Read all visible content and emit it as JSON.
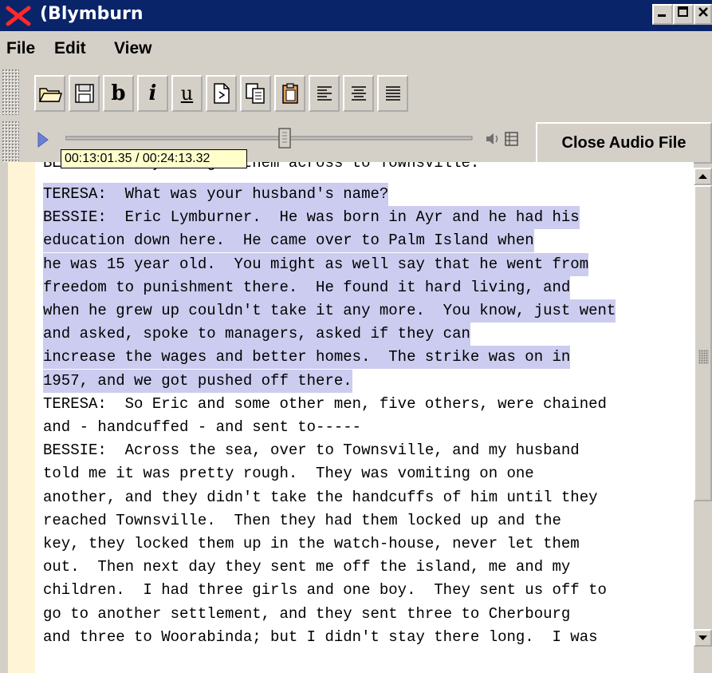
{
  "window": {
    "title": "(Blymburn"
  },
  "menu": {
    "file": "File",
    "edit": "Edit",
    "view": "View"
  },
  "toolbar": {
    "buttons": [
      "open",
      "save",
      "b",
      "i",
      "u",
      "new-page",
      "copy-page",
      "paste",
      "align-left",
      "align-center",
      "align-justify"
    ],
    "bold_label": "b",
    "italic_label": "i",
    "underline_label": "u"
  },
  "audio": {
    "position_fraction": 0.54,
    "time_display": "00:13:01.35 / 00:24:13.32",
    "close_label": "Close Audio File"
  },
  "transcript": {
    "lines": [
      {
        "text": "TERESA:  What was your husband's name?",
        "selected": true
      },
      {
        "text": "BESSIE:  Eric Lymburner.  He was born in Ayr and he had his",
        "selected": true
      },
      {
        "text": "education down here.  He came over to Palm Island when",
        "selected": true
      },
      {
        "text": "he was 15 year old.  You might as well say that he went from",
        "selected": true
      },
      {
        "text": "freedom to punishment there.  He found it hard living, and",
        "selected": true
      },
      {
        "text": "when he grew up couldn't take it any more.  You know, just went",
        "selected": true
      },
      {
        "text": "and asked, spoke to managers, asked if they can",
        "selected": true
      },
      {
        "text": "increase the wages and better homes.  The strike was on in",
        "selected": true
      },
      {
        "text": "1957, and we got pushed off there.",
        "selected": true
      },
      {
        "text": "TERESA:  So Eric and some other men, five others, were chained",
        "selected": false
      },
      {
        "text": "and - handcuffed - and sent to-----",
        "selected": false
      },
      {
        "text": "BESSIE:  Across the sea, over to Townsville, and my husband",
        "selected": false
      },
      {
        "text": "told me it was pretty rough.  They was vomiting on one",
        "selected": false
      },
      {
        "text": "another, and they didn't take the handcuffs of him until they",
        "selected": false
      },
      {
        "text": "reached Townsville.  Then they had them locked up and the",
        "selected": false
      },
      {
        "text": "key, they locked them up in the watch-house, never let them",
        "selected": false
      },
      {
        "text": "out.  Then next day they sent me off the island, me and my",
        "selected": false
      },
      {
        "text": "children.  I had three girls and one boy.  They sent us off to",
        "selected": false
      },
      {
        "text": "go to another settlement, and they sent three to Cherbourg",
        "selected": false
      },
      {
        "text": "and three to Woorabinda; but I didn't stay there long.  I was",
        "selected": false
      }
    ]
  }
}
